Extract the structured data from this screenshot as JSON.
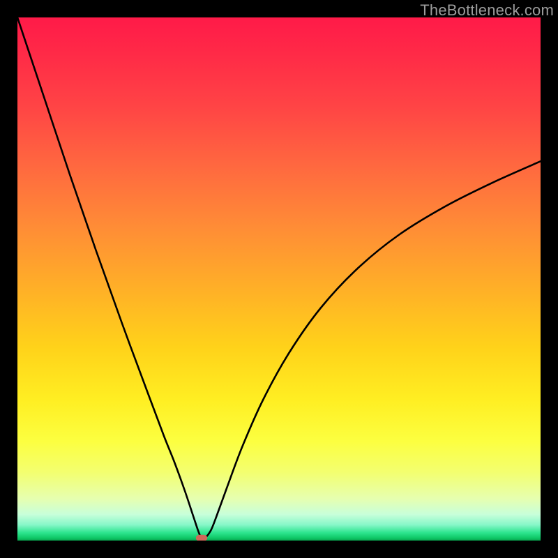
{
  "watermark": "TheBottleneck.com",
  "chart_data": {
    "type": "line",
    "title": "",
    "xlabel": "",
    "ylabel": "",
    "xlim": [
      0,
      100
    ],
    "ylim": [
      0,
      100
    ],
    "grid": false,
    "legend": false,
    "annotations": [],
    "series": [
      {
        "name": "bottleneck-curve",
        "color": "#000000",
        "x": [
          0,
          5,
          10,
          15,
          20,
          25,
          28,
          30,
          32,
          33.5,
          34.5,
          35,
          35.5,
          36,
          37,
          38,
          40,
          43,
          47,
          52,
          58,
          65,
          73,
          82,
          91,
          100
        ],
        "y": [
          100,
          85,
          70,
          55.5,
          41.5,
          28,
          20,
          15,
          9.5,
          5,
          2,
          0.8,
          0.4,
          0.6,
          2,
          4.5,
          10,
          18,
          27,
          36,
          44.5,
          52,
          58.5,
          64,
          68.5,
          72.5
        ]
      }
    ],
    "marker": {
      "name": "minimum-point",
      "shape": "rounded-rect",
      "x": 35.2,
      "y": 0.5,
      "width": 2.2,
      "height": 1.2,
      "color": "#cf6759"
    },
    "background": {
      "type": "vertical-gradient",
      "stops": [
        {
          "pos": 0,
          "color": "#ff1a48"
        },
        {
          "pos": 40,
          "color": "#ff8c36"
        },
        {
          "pos": 73,
          "color": "#ffee22"
        },
        {
          "pos": 97,
          "color": "#86f7c8"
        },
        {
          "pos": 100,
          "color": "#08a64f"
        }
      ]
    }
  }
}
